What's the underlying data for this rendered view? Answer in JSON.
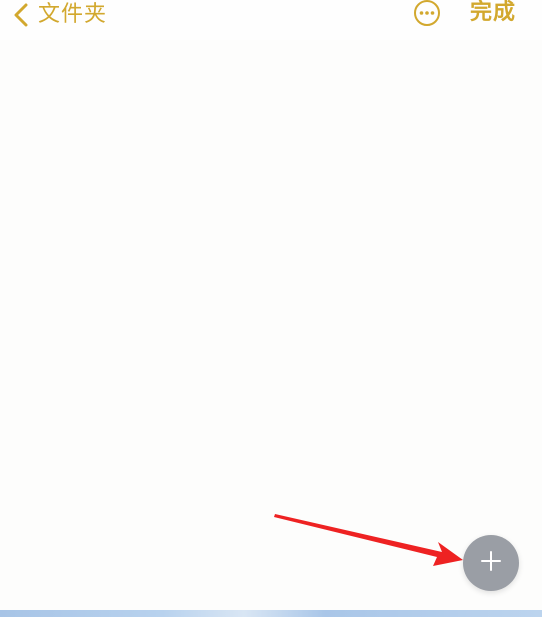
{
  "nav": {
    "back_label": "文件夹",
    "back_icon": "chevron-left-icon",
    "more_icon": "ellipsis-circle-icon",
    "done_label": "完成"
  },
  "fab": {
    "icon": "plus-icon"
  },
  "colors": {
    "accent": "#d2a82e",
    "fab_bg": "#9a9ea5",
    "annotation_arrow": "#ee2222"
  }
}
